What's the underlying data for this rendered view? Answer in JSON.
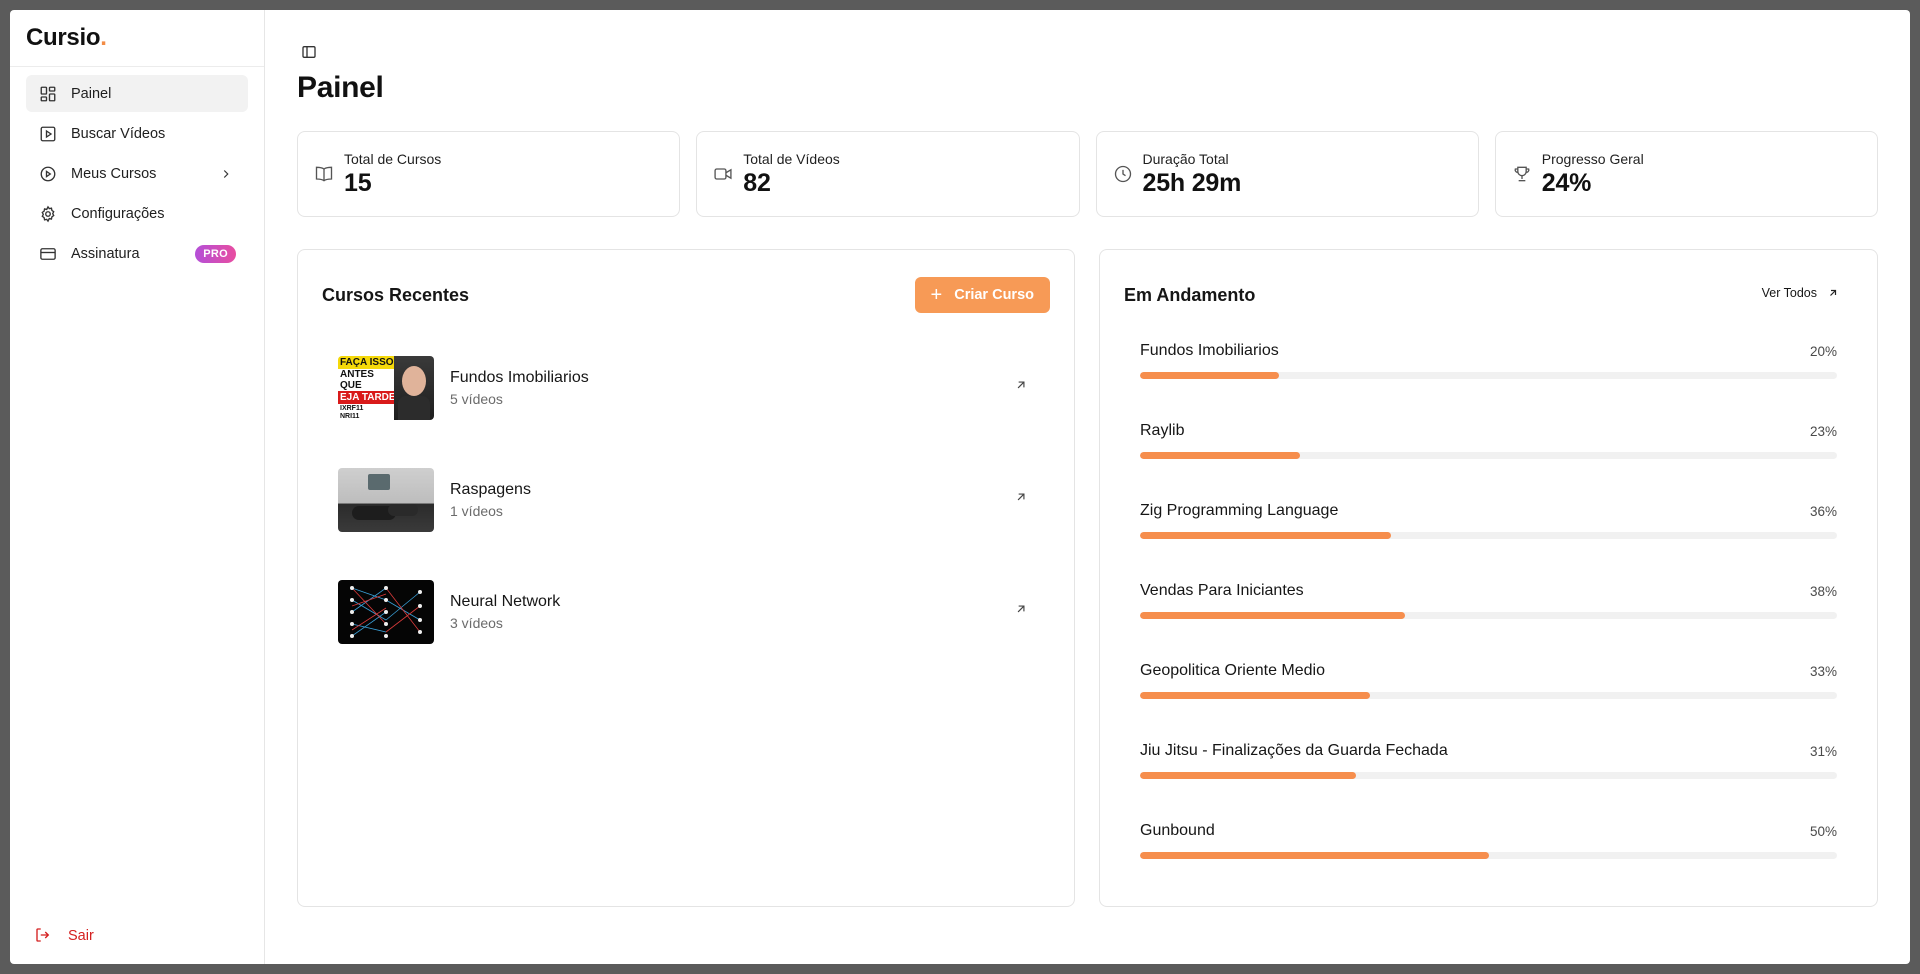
{
  "brand": {
    "name": "Cursio",
    "dot": "."
  },
  "sidebar": {
    "items": [
      {
        "label": "Painel",
        "icon": "dashboard-icon",
        "active": true
      },
      {
        "label": "Buscar Vídeos",
        "icon": "video-search-icon"
      },
      {
        "label": "Meus Cursos",
        "icon": "play-circle-icon"
      },
      {
        "label": "Configurações",
        "icon": "gear-icon"
      },
      {
        "label": "Assinatura",
        "icon": "credit-card-icon",
        "badge": "PRO"
      }
    ],
    "logout": "Sair"
  },
  "page": {
    "title": "Painel"
  },
  "stats": [
    {
      "label": "Total de Cursos",
      "value": "15",
      "icon": "book-icon"
    },
    {
      "label": "Total de Vídeos",
      "value": "82",
      "icon": "video-camera-icon"
    },
    {
      "label": "Duração Total",
      "value": "25h 29m",
      "icon": "clock-icon"
    },
    {
      "label": "Progresso Geral",
      "value": "24%",
      "icon": "trophy-icon"
    }
  ],
  "recent": {
    "title": "Cursos Recentes",
    "create_label": "Criar Curso",
    "courses": [
      {
        "name": "Fundos Imobiliarios",
        "meta": "5 vídeos"
      },
      {
        "name": "Raspagens",
        "meta": "1 vídeos"
      },
      {
        "name": "Neural Network",
        "meta": "3 vídeos"
      }
    ],
    "thumb_text": {
      "line1": "FAÇA ISSO",
      "line2": "ANTES QUE",
      "line3": "EJA TARDE",
      "line4": "IXRF11",
      "line5": "NRI11"
    }
  },
  "progress": {
    "title": "Em Andamento",
    "see_all": "Ver Todos",
    "items": [
      {
        "name": "Fundos Imobiliarios",
        "pct_label": "20%",
        "pct": 20
      },
      {
        "name": "Raylib",
        "pct_label": "23%",
        "pct": 23
      },
      {
        "name": "Zig Programming Language",
        "pct_label": "36%",
        "pct": 36
      },
      {
        "name": "Vendas Para Iniciantes",
        "pct_label": "38%",
        "pct": 38
      },
      {
        "name": "Geopolitica Oriente Medio",
        "pct_label": "33%",
        "pct": 33
      },
      {
        "name": "Jiu Jitsu - Finalizações da Guarda Fechada",
        "pct_label": "31%",
        "pct": 31
      },
      {
        "name": "Gunbound",
        "pct_label": "50%",
        "pct": 50
      }
    ]
  },
  "colors": {
    "accent": "#f68e4d",
    "logout": "#d41f1f",
    "pro_badge_start": "#b44fd8",
    "pro_badge_end": "#e84da0"
  }
}
